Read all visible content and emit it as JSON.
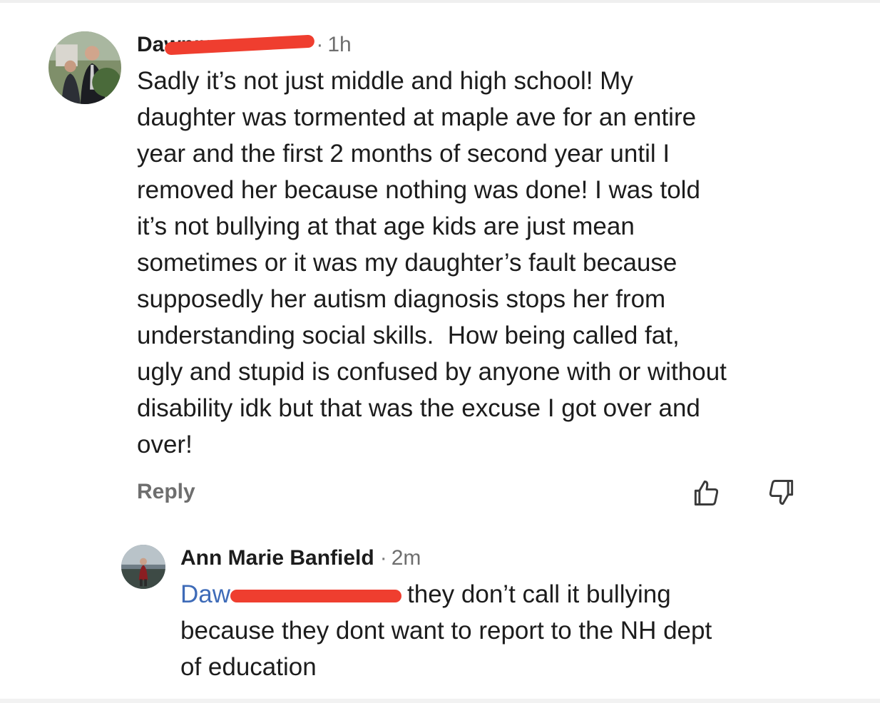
{
  "comments": [
    {
      "author": "Dawnma",
      "separator": "·",
      "time": "1h",
      "lines": [
        "Sadly it’s not just middle and high school! My",
        "daughter was tormented at maple ave for an entire",
        "year and the first 2 months of second year until I",
        "removed her because nothing was done! I was told",
        "it’s not bullying at that age kids are just mean",
        "sometimes or it was my daughter’s fault because",
        "supposedly her autism diagnosis stops her from",
        "understanding social skills.  How being called fat,",
        "ugly and stupid is confused by anyone with or without",
        "disability idk but that was the excuse I got over and",
        "over!"
      ],
      "reply_label": "Reply",
      "icons": {
        "upvote": "thumbs-up-icon",
        "downvote": "thumbs-down-icon"
      }
    },
    {
      "author": "Ann Marie Banfield",
      "separator": "·",
      "time": "2m",
      "mention": "Daw",
      "first_line_rest": "they don’t call it bullying",
      "lines": [
        "because they dont want to report to the NH dept",
        "of education"
      ]
    }
  ],
  "colors": {
    "redaction": "#ef3e2f",
    "mention": "#3e6bb8",
    "muted": "#6e6e6e"
  }
}
